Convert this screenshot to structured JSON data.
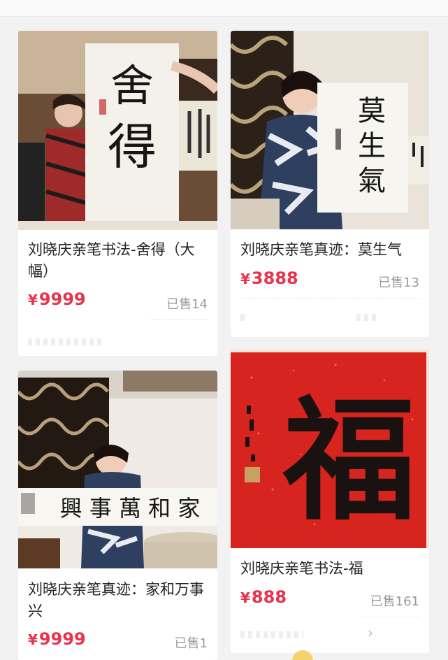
{
  "products": [
    {
      "title": "刘晓庆亲笔书法-舍得（大幅）",
      "currency": "¥",
      "price": "9999",
      "sold": "已售14",
      "scroll_text": [
        "舍",
        "得"
      ]
    },
    {
      "title": "刘晓庆亲笔真迹：莫生气",
      "currency": "¥",
      "price": "3888",
      "sold": "已售13",
      "scroll_text": [
        "莫",
        "生",
        "氣"
      ]
    },
    {
      "title": "刘晓庆亲笔真迹：家和万事兴",
      "currency": "¥",
      "price": "9999",
      "sold": "已售1",
      "scroll_text": "興 事 萬 和 家"
    },
    {
      "title": "刘晓庆亲笔书法-福",
      "currency": "¥",
      "price": "888",
      "sold": "已售161",
      "scroll_text": "福"
    }
  ],
  "colors": {
    "price": "#e8344e",
    "background": "#f2f2f2",
    "card": "#ffffff",
    "fu_red": "#d8241e"
  }
}
